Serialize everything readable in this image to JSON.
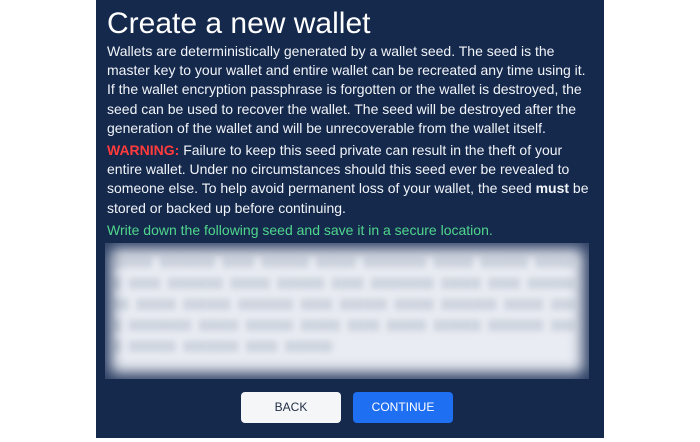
{
  "page": {
    "title": "Create a new wallet",
    "intro": "Wallets are deterministically generated by a wallet seed. The seed is the master key to your wallet and entire wallet can be recreated any time using it. If the wallet encryption passphrase is forgotten or the wallet is destroyed, the seed can be used to recover the wallet. The seed will be destroyed after the generation of the wallet and will be unrecoverable from the wallet itself.",
    "warning_label": "WARNING:",
    "warning_text_before": " Failure to keep this seed private can result in the theft of your entire wallet. Under no circumstances should this seed ever be revealed to someone else. To help avoid permanent loss of your wallet, the seed ",
    "warning_emphasis": "must",
    "warning_text_after": " be stored or backed up before continuing.",
    "instruction": "Write down the following seed and save it in a secure location."
  },
  "buttons": {
    "back_label": "BACK",
    "continue_label": "CONTINUE"
  },
  "colors": {
    "panel_bg": "#15294d",
    "warning": "#ff3b3b",
    "instruction": "#4fd68c",
    "primary_button": "#1f6ff2"
  }
}
